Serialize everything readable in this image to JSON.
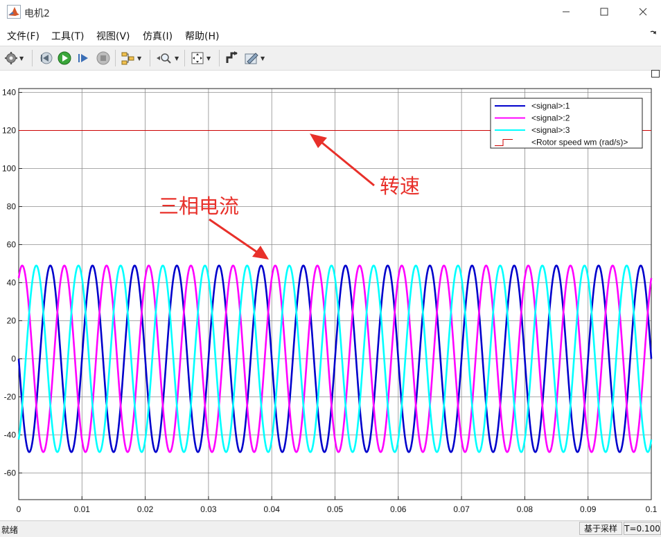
{
  "window": {
    "title": "电机2",
    "minimize_glyph": "—",
    "maximize_glyph": "☐",
    "close_glyph": "✕"
  },
  "menu": [
    "文件(F)",
    "工具(T)",
    "视图(V)",
    "仿真(I)",
    "帮助(H)"
  ],
  "toolbar": {
    "icons": [
      "gear-icon",
      "step-back-icon",
      "run-icon",
      "step-forward-icon",
      "stop-icon",
      "signal-select-icon",
      "zoom-icon",
      "autoscale-icon",
      "highlight-block-icon",
      "style-icon"
    ]
  },
  "status": {
    "left_text": "就绪",
    "mode": "基于采样",
    "time": "T=0.100"
  },
  "annotations": {
    "speed": "转速",
    "current": "三相电流",
    "color": "#e8302a"
  },
  "chart_data": {
    "type": "line",
    "xlim": [
      0,
      0.1
    ],
    "ylim": [
      -74,
      142
    ],
    "xticks": [
      0,
      0.01,
      0.02,
      0.03,
      0.04,
      0.05,
      0.06,
      0.07,
      0.08,
      0.09,
      0.1
    ],
    "xtick_labels": [
      "0",
      "0.01",
      "0.02",
      "0.03",
      "0.04",
      "0.05",
      "0.06",
      "0.07",
      "0.08",
      "0.09",
      "0.1"
    ],
    "yticks": [
      -60,
      -40,
      -20,
      0,
      20,
      40,
      60,
      80,
      100,
      120,
      140
    ],
    "ytick_labels": [
      "-60",
      "-40",
      "-20",
      "0",
      "20",
      "40",
      "60",
      "80",
      "100",
      "120",
      "140"
    ],
    "grid": true,
    "legend_position": "top-right",
    "series": [
      {
        "name": "<signal>:1",
        "color": "#0000cc",
        "kind": "sine",
        "amplitude": 49,
        "frequency_hz": 150,
        "phase_deg": 180
      },
      {
        "name": "<signal>:2",
        "color": "#ff00ff",
        "kind": "sine",
        "amplitude": 49,
        "frequency_hz": 150,
        "phase_deg": 60
      },
      {
        "name": "<signal>:3",
        "color": "#00ffff",
        "kind": "sine",
        "amplitude": 49,
        "frequency_hz": 150,
        "phase_deg": -60
      },
      {
        "name": "<Rotor speed wm (rad/s)>",
        "color": "#cc0000",
        "kind": "constant",
        "value": 120
      }
    ]
  }
}
